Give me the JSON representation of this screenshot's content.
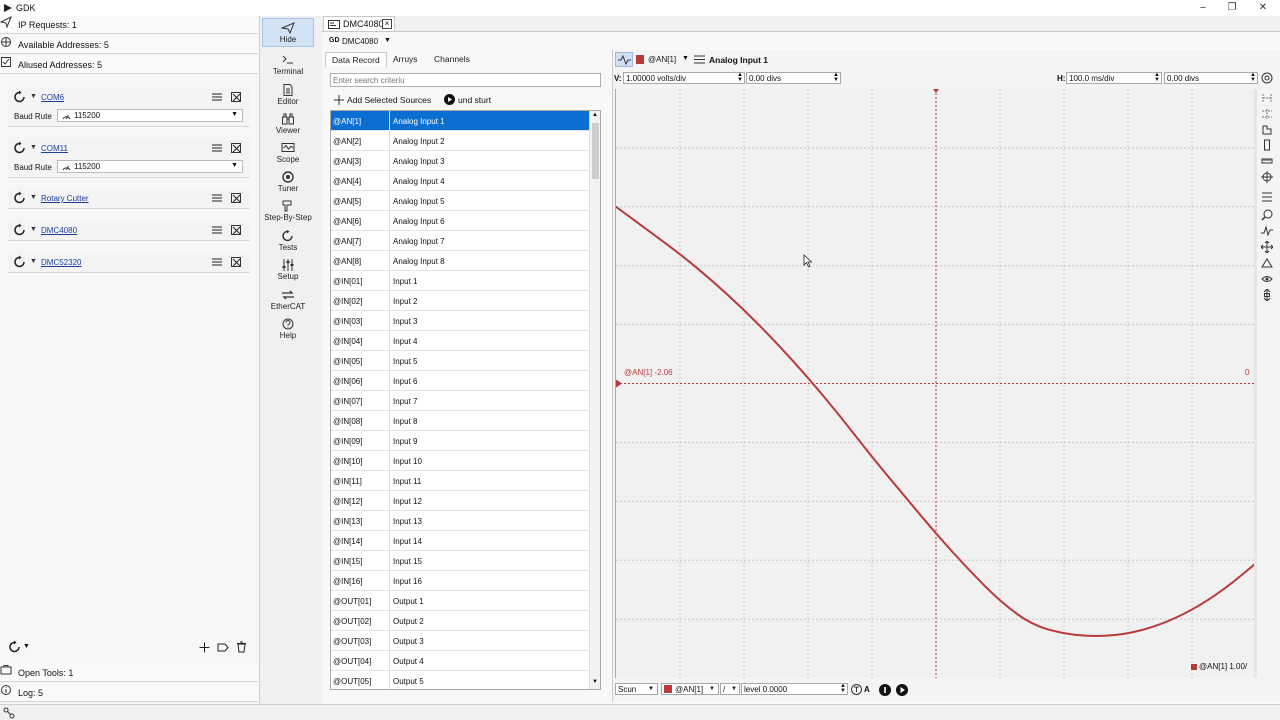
{
  "app": {
    "title": "GDK"
  },
  "left_panel": {
    "ip_requests": "IP Requests: 1",
    "available_addresses": "Available Addresses: 5",
    "aliased_addresses": "Aliused Addresses: 5",
    "controllers": [
      {
        "name": "COM6",
        "baud_label": "Baud Rute",
        "baud_value": "115200"
      },
      {
        "name": "COM11",
        "baud_label": "Baud Rute",
        "baud_value": "115200"
      },
      {
        "name": "Rotary Cutter"
      },
      {
        "name": "DMC4080"
      },
      {
        "name": "DMC52320"
      }
    ],
    "open_tools": "Open Tools: 1",
    "log": "Log: 5"
  },
  "tools": [
    {
      "label": "Hide",
      "icon": "send-icon"
    },
    {
      "label": "Terminal",
      "icon": "terminal-icon"
    },
    {
      "label": "Editor",
      "icon": "document-icon"
    },
    {
      "label": "Viewer",
      "icon": "binoculars-icon"
    },
    {
      "label": "Scope",
      "icon": "scope-icon"
    },
    {
      "label": "Tuner",
      "icon": "target-icon"
    },
    {
      "label": "Step-By-Step",
      "icon": "step-icon"
    },
    {
      "label": "Tests",
      "icon": "refresh-icon"
    },
    {
      "label": "Setup",
      "icon": "sliders-icon"
    },
    {
      "label": "EtherCAT",
      "icon": "ethercat-icon"
    },
    {
      "label": "Help",
      "icon": "help-icon"
    }
  ],
  "document": {
    "tab_label": "DMC4080",
    "controller_selector": "DMC4080"
  },
  "data_record": {
    "tabs": [
      "Data Record",
      "Arruys",
      "Channels"
    ],
    "search_placeholder": "Enter search criteriu",
    "add_sources": "Add Selected Sources",
    "and_start": "und sturt",
    "rows": [
      {
        "id": "@AN[1]",
        "name": "Analog Input 1",
        "selected": true
      },
      {
        "id": "@AN[2]",
        "name": "Analog Input 2"
      },
      {
        "id": "@AN[3]",
        "name": "Analog Input 3"
      },
      {
        "id": "@AN[4]",
        "name": "Analog Input 4"
      },
      {
        "id": "@AN[5]",
        "name": "Analog Input 5"
      },
      {
        "id": "@AN[6]",
        "name": "Analog Input 6"
      },
      {
        "id": "@AN[7]",
        "name": "Analog Input 7"
      },
      {
        "id": "@AN[8]",
        "name": "Analog Input 8"
      },
      {
        "id": "@IN[01]",
        "name": "Input 1"
      },
      {
        "id": "@IN[02]",
        "name": "Input 2"
      },
      {
        "id": "@IN[03]",
        "name": "Input 3"
      },
      {
        "id": "@IN[04]",
        "name": "Input 4"
      },
      {
        "id": "@IN[05]",
        "name": "Input 5"
      },
      {
        "id": "@IN[06]",
        "name": "Input 6"
      },
      {
        "id": "@IN[07]",
        "name": "Input 7"
      },
      {
        "id": "@IN[08]",
        "name": "Input 8"
      },
      {
        "id": "@IN[09]",
        "name": "Input 9"
      },
      {
        "id": "@IN[10]",
        "name": "Input 10"
      },
      {
        "id": "@IN[11]",
        "name": "Input 11"
      },
      {
        "id": "@IN[12]",
        "name": "Input 12"
      },
      {
        "id": "@IN[13]",
        "name": "Input 13"
      },
      {
        "id": "@IN[14]",
        "name": "Input 14"
      },
      {
        "id": "@IN[15]",
        "name": "Input 15"
      },
      {
        "id": "@IN[16]",
        "name": "Input 16"
      },
      {
        "id": "@OUT[01]",
        "name": "Output 1"
      },
      {
        "id": "@OUT[02]",
        "name": "Output 2"
      },
      {
        "id": "@OUT[03]",
        "name": "Output 3"
      },
      {
        "id": "@OUT[04]",
        "name": "Output 4"
      },
      {
        "id": "@OUT[05]",
        "name": "Output 5"
      }
    ]
  },
  "scope": {
    "channel": "@AN[1]",
    "channel_title": "Analog Input 1",
    "v_label": "V:",
    "v_scale": "1.00000 volts/div",
    "v_offset": "0.00 divs",
    "h_label": "H:",
    "h_scale": "100.0 ms/div",
    "h_offset": "0.00 divs",
    "marker_label": "@AN[1] -2.06",
    "marker_right": "0",
    "legend": "@AN[1] 1.00/",
    "mode": "Scun",
    "trigger_channel": "@AN[1]",
    "trigger_slope": "/",
    "trigger_level": "level 0.0000",
    "auto_label": "A",
    "trace_color": "#b83a3a"
  },
  "chart_data": {
    "type": "line",
    "x_divisions": 10,
    "y_divisions": 10,
    "v_per_div": 1.0,
    "ms_per_div": 100.0,
    "grid": true,
    "series": [
      {
        "name": "@AN[1]",
        "x": [
          0,
          50,
          100,
          150,
          200,
          250,
          300,
          350,
          400,
          450,
          500,
          550,
          600,
          650,
          700,
          750,
          800,
          850,
          900,
          950,
          1000
        ],
        "y": [
          3.0,
          2.6,
          2.2,
          1.75,
          1.25,
          0.7,
          0.1,
          -0.55,
          -1.25,
          -1.9,
          -2.55,
          -3.15,
          -3.7,
          -4.1,
          -4.25,
          -4.3,
          -4.25,
          -4.1,
          -3.85,
          -3.5,
          -3.05
        ]
      }
    ]
  }
}
